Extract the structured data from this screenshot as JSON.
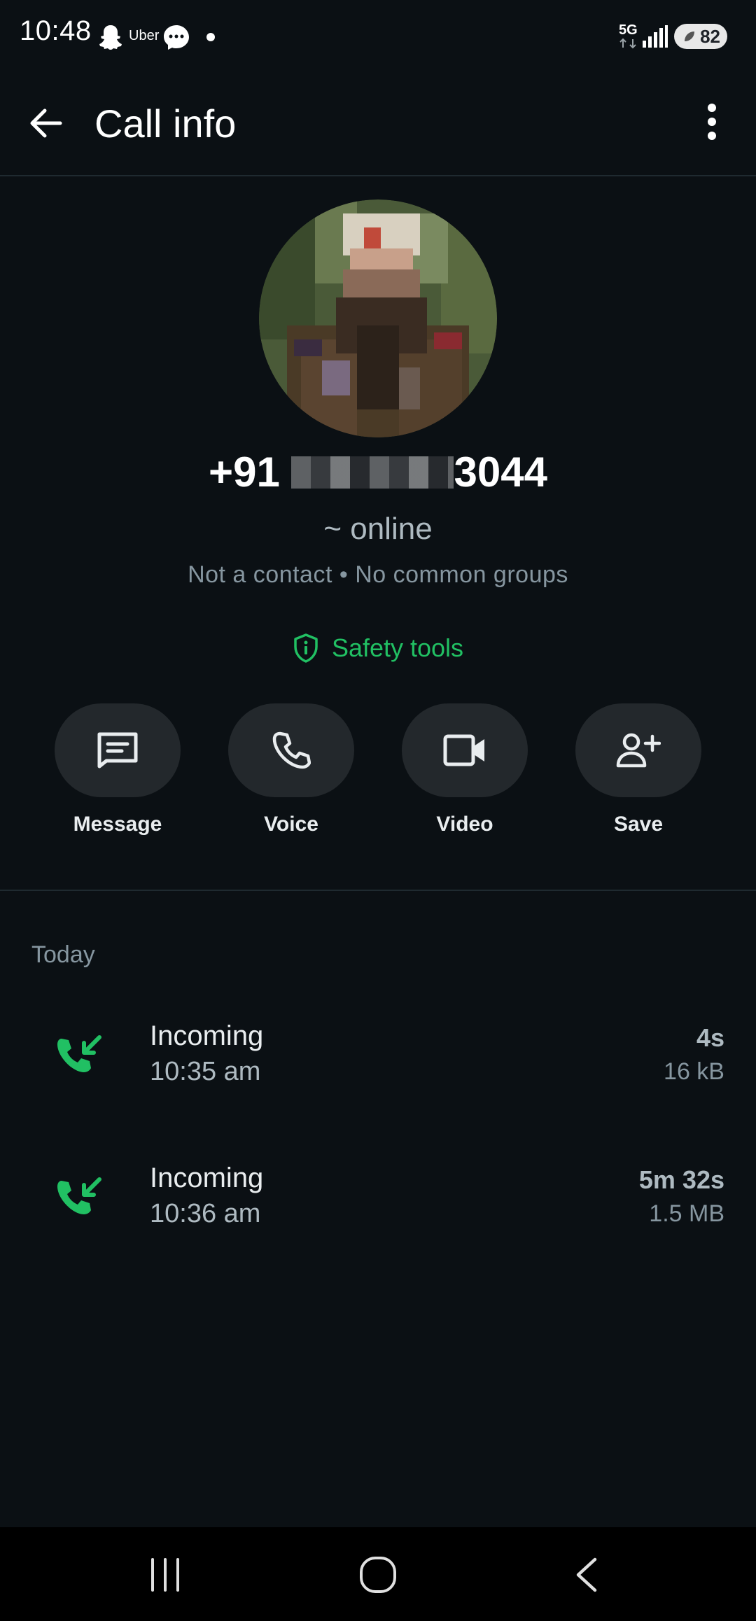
{
  "status_bar": {
    "time": "10:48",
    "notification_icons": [
      "snapchat-icon",
      "uber-icon",
      "messenger-icon",
      "dot-icon"
    ],
    "uber_text": "Uber",
    "network": "5G",
    "battery": "82"
  },
  "appbar": {
    "title": "Call info"
  },
  "profile": {
    "phone_prefix": "+91",
    "phone_suffix": "3044",
    "status": "~ online",
    "meta": "Not a contact • No common groups",
    "safety_label": "Safety tools"
  },
  "actions": [
    {
      "label": "Message",
      "icon": "message-icon"
    },
    {
      "label": "Voice",
      "icon": "phone-icon"
    },
    {
      "label": "Video",
      "icon": "video-icon"
    },
    {
      "label": "Save",
      "icon": "add-contact-icon"
    }
  ],
  "calls": {
    "section": "Today",
    "items": [
      {
        "type": "Incoming",
        "time": "10:35 am",
        "duration": "4s",
        "size": "16 kB"
      },
      {
        "type": "Incoming",
        "time": "10:36 am",
        "duration": "5m 32s",
        "size": "1.5 MB"
      }
    ]
  },
  "colors": {
    "background": "#0b1014",
    "accent_green": "#21c063",
    "button_bg": "#23282c"
  }
}
